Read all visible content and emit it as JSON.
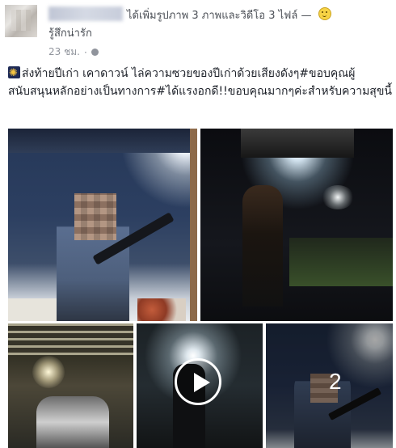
{
  "post": {
    "header_action": "ได้เพิ่มรูปภาพ 3 ภาพและวิดีโอ 3 ไฟล์ — ",
    "feeling": "รู้สึกน่ารัก",
    "time": "23 ชม.",
    "dot": "·",
    "caption": "ส่งท้ายปีเก่า เคาดาวน์ ไล่ความซวยของปีเก่าด้วยเสียงดังๆ#ขอบคุณผู้สนับสนุนหลักอย่างเป็นทางการ#ได้แรงอกดี!!ขอบคุณมากๆค่ะสำหรับความสุขนี้"
  },
  "media": {
    "more_count": "2"
  },
  "icons": {
    "feeling_icon": "smiley-icon",
    "privacy_icon": "globe-icon",
    "caption_icon": "fireworks-icon",
    "play_icon": "play-icon"
  }
}
